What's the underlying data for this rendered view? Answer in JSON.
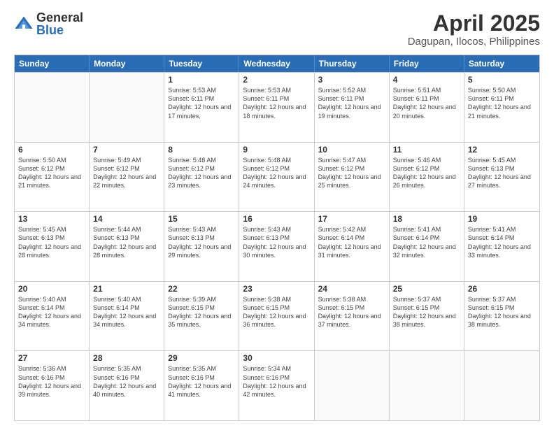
{
  "logo": {
    "general": "General",
    "blue": "Blue"
  },
  "title": "April 2025",
  "subtitle": "Dagupan, Ilocos, Philippines",
  "header_days": [
    "Sunday",
    "Monday",
    "Tuesday",
    "Wednesday",
    "Thursday",
    "Friday",
    "Saturday"
  ],
  "weeks": [
    [
      {
        "day": "",
        "info": ""
      },
      {
        "day": "",
        "info": ""
      },
      {
        "day": "1",
        "info": "Sunrise: 5:53 AM\nSunset: 6:11 PM\nDaylight: 12 hours and 17 minutes."
      },
      {
        "day": "2",
        "info": "Sunrise: 5:53 AM\nSunset: 6:11 PM\nDaylight: 12 hours and 18 minutes."
      },
      {
        "day": "3",
        "info": "Sunrise: 5:52 AM\nSunset: 6:11 PM\nDaylight: 12 hours and 19 minutes."
      },
      {
        "day": "4",
        "info": "Sunrise: 5:51 AM\nSunset: 6:11 PM\nDaylight: 12 hours and 20 minutes."
      },
      {
        "day": "5",
        "info": "Sunrise: 5:50 AM\nSunset: 6:11 PM\nDaylight: 12 hours and 21 minutes."
      }
    ],
    [
      {
        "day": "6",
        "info": "Sunrise: 5:50 AM\nSunset: 6:12 PM\nDaylight: 12 hours and 21 minutes."
      },
      {
        "day": "7",
        "info": "Sunrise: 5:49 AM\nSunset: 6:12 PM\nDaylight: 12 hours and 22 minutes."
      },
      {
        "day": "8",
        "info": "Sunrise: 5:48 AM\nSunset: 6:12 PM\nDaylight: 12 hours and 23 minutes."
      },
      {
        "day": "9",
        "info": "Sunrise: 5:48 AM\nSunset: 6:12 PM\nDaylight: 12 hours and 24 minutes."
      },
      {
        "day": "10",
        "info": "Sunrise: 5:47 AM\nSunset: 6:12 PM\nDaylight: 12 hours and 25 minutes."
      },
      {
        "day": "11",
        "info": "Sunrise: 5:46 AM\nSunset: 6:12 PM\nDaylight: 12 hours and 26 minutes."
      },
      {
        "day": "12",
        "info": "Sunrise: 5:45 AM\nSunset: 6:13 PM\nDaylight: 12 hours and 27 minutes."
      }
    ],
    [
      {
        "day": "13",
        "info": "Sunrise: 5:45 AM\nSunset: 6:13 PM\nDaylight: 12 hours and 28 minutes."
      },
      {
        "day": "14",
        "info": "Sunrise: 5:44 AM\nSunset: 6:13 PM\nDaylight: 12 hours and 28 minutes."
      },
      {
        "day": "15",
        "info": "Sunrise: 5:43 AM\nSunset: 6:13 PM\nDaylight: 12 hours and 29 minutes."
      },
      {
        "day": "16",
        "info": "Sunrise: 5:43 AM\nSunset: 6:13 PM\nDaylight: 12 hours and 30 minutes."
      },
      {
        "day": "17",
        "info": "Sunrise: 5:42 AM\nSunset: 6:14 PM\nDaylight: 12 hours and 31 minutes."
      },
      {
        "day": "18",
        "info": "Sunrise: 5:41 AM\nSunset: 6:14 PM\nDaylight: 12 hours and 32 minutes."
      },
      {
        "day": "19",
        "info": "Sunrise: 5:41 AM\nSunset: 6:14 PM\nDaylight: 12 hours and 33 minutes."
      }
    ],
    [
      {
        "day": "20",
        "info": "Sunrise: 5:40 AM\nSunset: 6:14 PM\nDaylight: 12 hours and 34 minutes."
      },
      {
        "day": "21",
        "info": "Sunrise: 5:40 AM\nSunset: 6:14 PM\nDaylight: 12 hours and 34 minutes."
      },
      {
        "day": "22",
        "info": "Sunrise: 5:39 AM\nSunset: 6:15 PM\nDaylight: 12 hours and 35 minutes."
      },
      {
        "day": "23",
        "info": "Sunrise: 5:38 AM\nSunset: 6:15 PM\nDaylight: 12 hours and 36 minutes."
      },
      {
        "day": "24",
        "info": "Sunrise: 5:38 AM\nSunset: 6:15 PM\nDaylight: 12 hours and 37 minutes."
      },
      {
        "day": "25",
        "info": "Sunrise: 5:37 AM\nSunset: 6:15 PM\nDaylight: 12 hours and 38 minutes."
      },
      {
        "day": "26",
        "info": "Sunrise: 5:37 AM\nSunset: 6:15 PM\nDaylight: 12 hours and 38 minutes."
      }
    ],
    [
      {
        "day": "27",
        "info": "Sunrise: 5:36 AM\nSunset: 6:16 PM\nDaylight: 12 hours and 39 minutes."
      },
      {
        "day": "28",
        "info": "Sunrise: 5:35 AM\nSunset: 6:16 PM\nDaylight: 12 hours and 40 minutes."
      },
      {
        "day": "29",
        "info": "Sunrise: 5:35 AM\nSunset: 6:16 PM\nDaylight: 12 hours and 41 minutes."
      },
      {
        "day": "30",
        "info": "Sunrise: 5:34 AM\nSunset: 6:16 PM\nDaylight: 12 hours and 42 minutes."
      },
      {
        "day": "",
        "info": ""
      },
      {
        "day": "",
        "info": ""
      },
      {
        "day": "",
        "info": ""
      }
    ]
  ]
}
